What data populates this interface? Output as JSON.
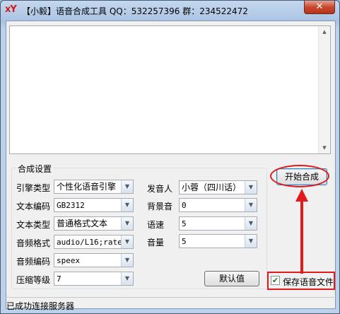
{
  "window": {
    "title": "【小毅】语音合成工具 QQ：532257396 群：234522472",
    "icon": "xy-logo-icon",
    "logo_text": "xY",
    "close_label": "✕"
  },
  "text_input": {
    "value": ""
  },
  "group": {
    "title": "合成设置",
    "engine_label": "引擎类型",
    "engine_value": "个性化语音引擎",
    "encoding_label": "文本编码",
    "encoding_value": "GB2312",
    "text_type_label": "文本类型",
    "text_type_value": "普通格式文本",
    "audio_format_label": "音频格式",
    "audio_format_value": "audio/L16;rate=",
    "audio_codec_label": "音频编码",
    "audio_codec_value": "speex",
    "compress_label": "压缩等级",
    "compress_value": "7",
    "speaker_label": "发音人",
    "speaker_value": "小蓉（四川话）",
    "bg_sound_label": "背景音",
    "bg_sound_value": "0",
    "speed_label": "语速",
    "speed_value": "5",
    "volume_label": "音量",
    "volume_value": "5",
    "default_button": "默认值"
  },
  "start_button": "开始合成",
  "save_checkbox": {
    "label": "保存语音文件",
    "checked": true
  },
  "status": "已成功连接服务器",
  "annotation_color": "#e3191c"
}
